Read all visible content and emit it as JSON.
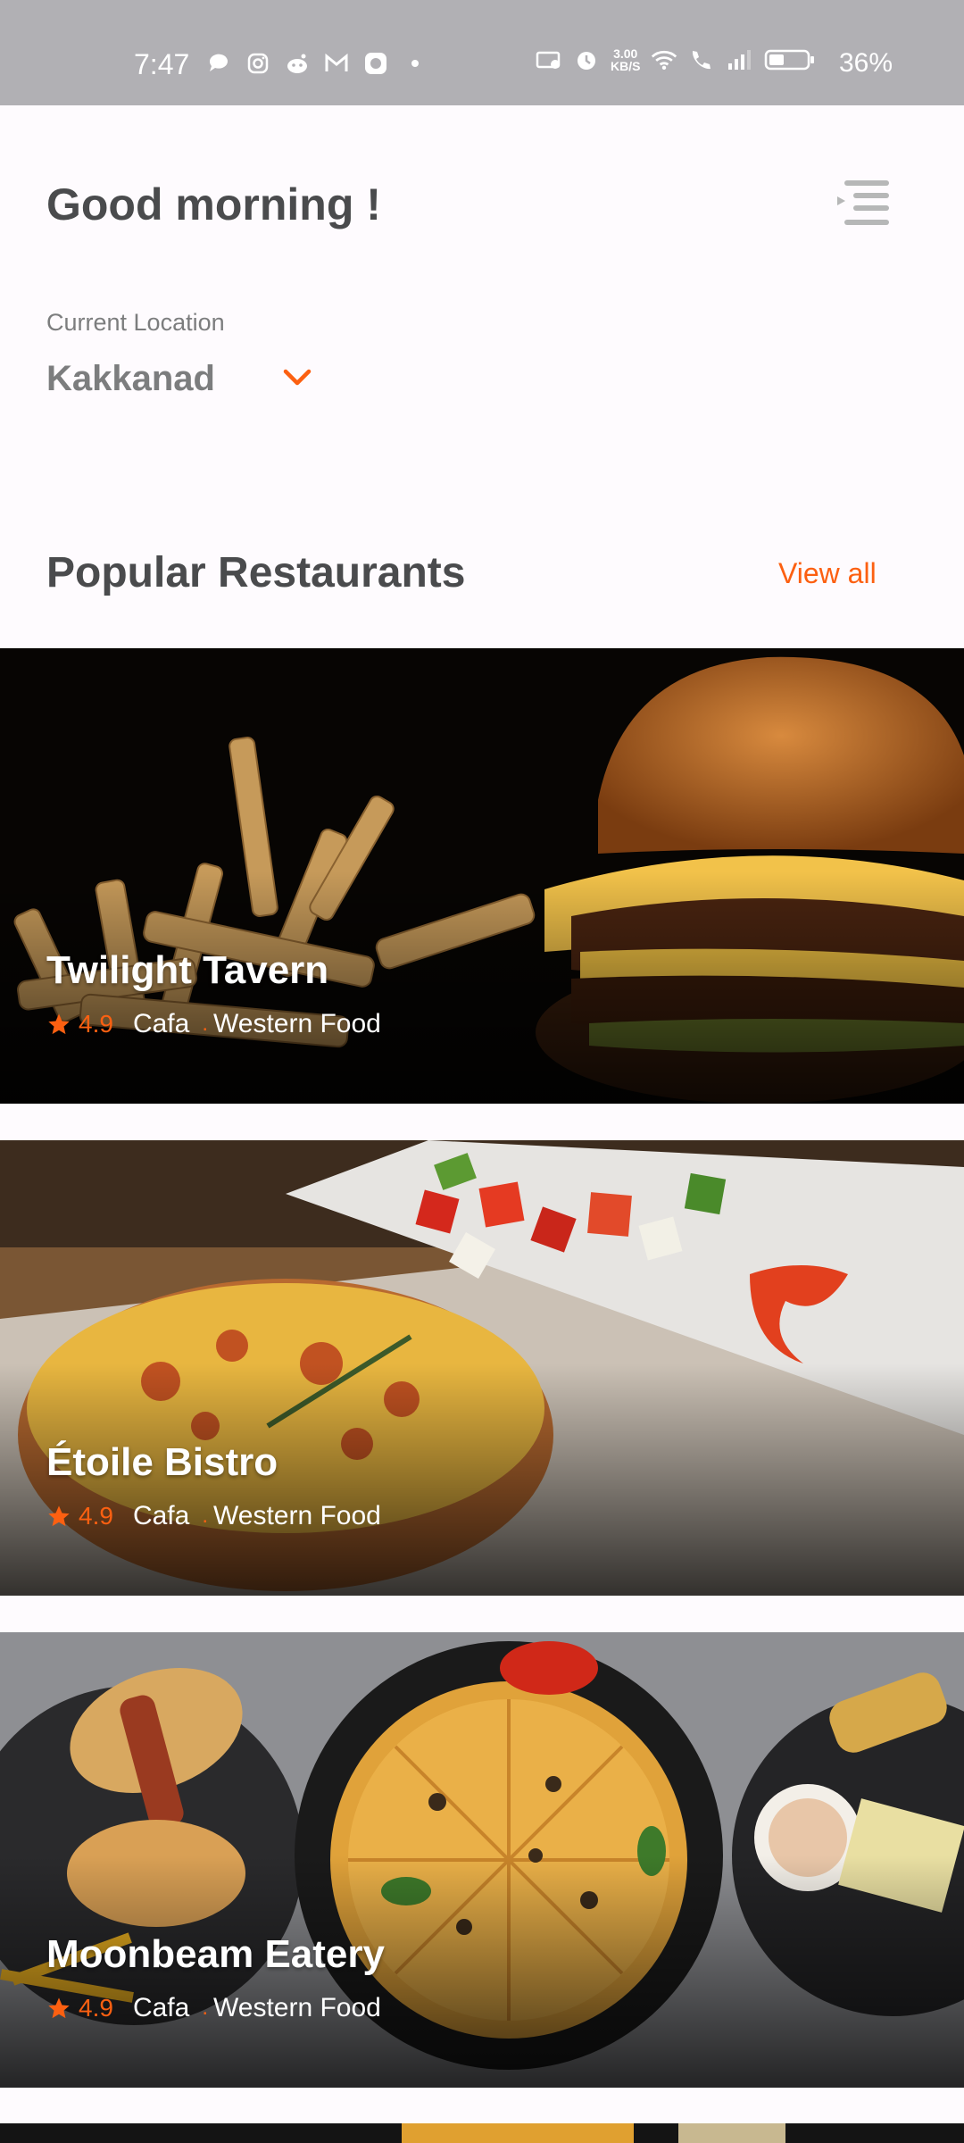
{
  "status_bar": {
    "time": "7:47",
    "network_speed": "3.00",
    "network_unit": "KB/S",
    "battery": "36%"
  },
  "header": {
    "greeting": "Good morning !",
    "location_label": "Current Location",
    "location_value": "Kakkanad"
  },
  "section": {
    "title": "Popular Restaurants",
    "view_all": "View all"
  },
  "restaurants": [
    {
      "name": "Twilight Tavern",
      "rating": "4.9",
      "type": "Cafa",
      "cuisine": "Western Food"
    },
    {
      "name": "Étoile Bistro",
      "rating": "4.9",
      "type": "Cafa",
      "cuisine": "Western Food"
    },
    {
      "name": "Moonbeam Eatery",
      "rating": "4.9",
      "type": "Cafa",
      "cuisine": "Western Food"
    }
  ],
  "colors": {
    "accent": "#fc6011",
    "primary_text": "#4a4b4d",
    "secondary_text": "#7c7d7e"
  },
  "icons": {
    "menu": "menu-icon",
    "chevron": "chevron-down-icon",
    "star": "star-icon"
  }
}
